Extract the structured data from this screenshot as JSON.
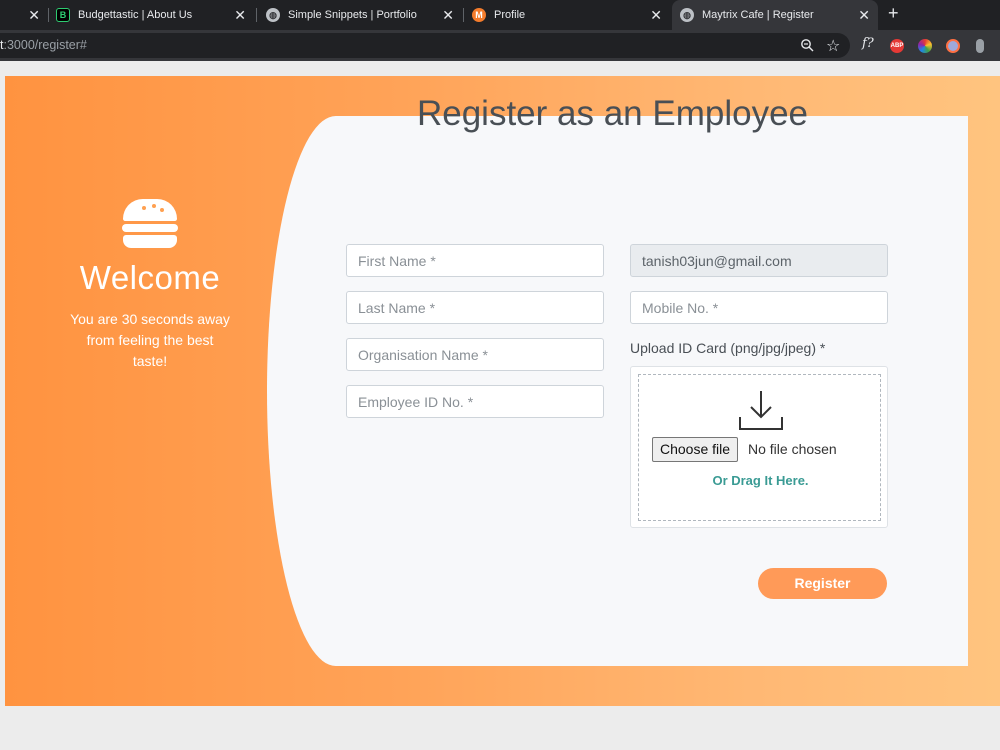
{
  "browser": {
    "tabs": [
      {
        "label": "",
        "icon": "close-icon"
      },
      {
        "label": "Budgettastic | About Us",
        "icon": "budgettastic-favicon"
      },
      {
        "label": "Simple Snippets | Portfolio",
        "icon": "globe-icon"
      },
      {
        "label": "Profile",
        "icon": "profile-favicon"
      },
      {
        "label": "Maytrix Cafe | Register",
        "icon": "globe-icon"
      }
    ],
    "url_prefix": "t",
    "url_rest": ":3000/register#",
    "ext_labels": {
      "f": "f?",
      "abp": "ABP"
    }
  },
  "left": {
    "icon": "burger-icon",
    "welcome": "Welcome",
    "tagline": "You are 30 seconds away from feeling the best taste!"
  },
  "form": {
    "title": "Register as an Employee",
    "first_name_placeholder": "First Name *",
    "last_name_placeholder": "Last Name *",
    "organisation_placeholder": "Organisation Name *",
    "employee_id_placeholder": "Employee ID No. *",
    "email_value": "tanish03jun@gmail.com",
    "mobile_placeholder": "Mobile No. *",
    "upload_label": "Upload ID Card (png/jpg/jpeg) *",
    "choose_file": "Choose file",
    "no_file": "No file chosen",
    "drag_text": "Or Drag It Here.",
    "register_button": "Register"
  },
  "colors": {
    "accent": "#ff9a58",
    "teal": "#3a9b94",
    "gradient_start": "#ff9340",
    "gradient_end": "#ffc47f"
  }
}
